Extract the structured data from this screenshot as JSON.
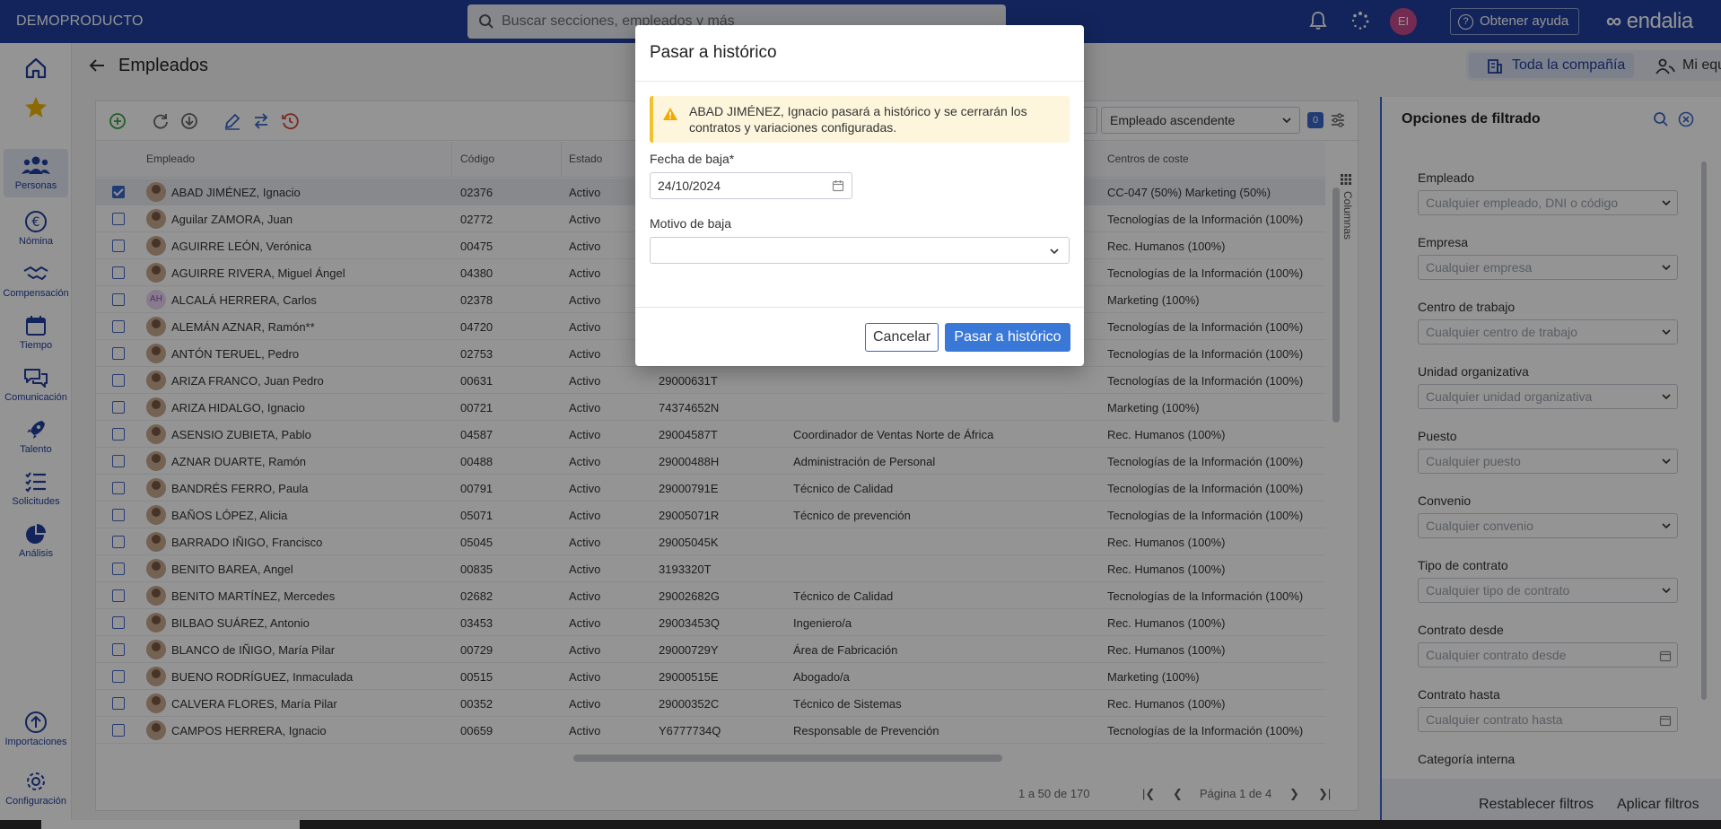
{
  "topbar": {
    "brand": "DEMOPRODUCTO",
    "search_placeholder": "Buscar secciones, empleados y más",
    "avatar_initials": "EI",
    "help_label": "Obtener ayuda",
    "logo_text": "endalia"
  },
  "leftnav": {
    "items": [
      {
        "label": "",
        "icon": "home-icon"
      },
      {
        "label": "",
        "icon": "star-icon"
      },
      {
        "label": "Personas",
        "icon": "people-icon"
      },
      {
        "label": "Nómina",
        "icon": "euro-icon"
      },
      {
        "label": "Compensación",
        "icon": "handshake-icon"
      },
      {
        "label": "Tiempo",
        "icon": "calendar-icon"
      },
      {
        "label": "Comunicación",
        "icon": "chat-icon"
      },
      {
        "label": "Talento",
        "icon": "rocket-icon"
      },
      {
        "label": "Solicitudes",
        "icon": "checklist-icon"
      },
      {
        "label": "Análisis",
        "icon": "pie-icon"
      },
      {
        "label": "Importaciones",
        "icon": "upload-icon"
      },
      {
        "label": "Configuración",
        "icon": "gear-icon"
      }
    ]
  },
  "page": {
    "title": "Empleados",
    "scope_tabs": [
      "Toda la compañía",
      "Mi equipo"
    ]
  },
  "grid": {
    "sort_value": "Empleado ascendente",
    "filter_count": "0",
    "columns_label": "Columnas",
    "headers": {
      "employee": "Empleado",
      "code": "Código",
      "state": "Estado",
      "cost_centers": "Centros de coste"
    },
    "rows": [
      {
        "name": "ABAD JIMÉNEZ, Ignacio",
        "code": "02376",
        "state": "Activo",
        "dni": "",
        "position": "",
        "cc": "CC-047 (50%) Marketing (50%)",
        "selected": true
      },
      {
        "name": "Aguilar ZAMORA, Juan",
        "code": "02772",
        "state": "Activo",
        "dni": "",
        "position": "",
        "cc": "Tecnologías de la Información (100%)"
      },
      {
        "name": "AGUIRRE LEÓN, Verónica",
        "code": "00475",
        "state": "Activo",
        "dni": "",
        "position": "",
        "cc": "Rec. Humanos (100%)"
      },
      {
        "name": "AGUIRRE RIVERA, Miguel Ángel",
        "code": "04380",
        "state": "Activo",
        "dni": "",
        "position": "",
        "cc": "Tecnologías de la Información (100%)"
      },
      {
        "name": "ALCALÁ HERRERA, Carlos",
        "code": "02378",
        "state": "Activo",
        "dni": "",
        "position": "",
        "cc": "Marketing (100%)",
        "initials": "AH"
      },
      {
        "name": "ALEMÁN AZNAR, Ramón**",
        "code": "04720",
        "state": "Activo",
        "dni": "",
        "position": "",
        "cc": "Tecnologías de la Información (100%)"
      },
      {
        "name": "ANTÓN TERUEL, Pedro",
        "code": "02753",
        "state": "Activo",
        "dni": "",
        "position": "",
        "cc": "Tecnologías de la Información (100%)"
      },
      {
        "name": "ARIZA FRANCO, Juan Pedro",
        "code": "00631",
        "state": "Activo",
        "dni": "29000631T",
        "position": "",
        "cc": "Tecnologías de la Información (100%)"
      },
      {
        "name": "ARIZA HIDALGO, Ignacio",
        "code": "00721",
        "state": "Activo",
        "dni": "74374652N",
        "position": "",
        "cc": "Marketing (100%)"
      },
      {
        "name": "ASENSIO ZUBIETA, Pablo",
        "code": "04587",
        "state": "Activo",
        "dni": "29004587T",
        "position": "Coordinador de Ventas Norte de África",
        "cc": "Rec. Humanos (100%)"
      },
      {
        "name": "AZNAR DUARTE, Ramón",
        "code": "00488",
        "state": "Activo",
        "dni": "29000488H",
        "position": "Administración de Personal",
        "cc": "Tecnologías de la Información (100%)"
      },
      {
        "name": "BANDRÉS FERRO, Paula",
        "code": "00791",
        "state": "Activo",
        "dni": "29000791E",
        "position": "Técnico de Calidad",
        "cc": "Tecnologías de la Información (100%)"
      },
      {
        "name": "BAÑOS LÓPEZ, Alicia",
        "code": "05071",
        "state": "Activo",
        "dni": "29005071R",
        "position": "Técnico de prevención",
        "cc": "Tecnologías de la Información (100%)"
      },
      {
        "name": "BARRADO IÑIGO, Francisco",
        "code": "05045",
        "state": "Activo",
        "dni": "29005045K",
        "position": "",
        "cc": "Rec. Humanos (100%)"
      },
      {
        "name": "BENITO BAREA, Angel",
        "code": "00835",
        "state": "Activo",
        "dni": "3193320T",
        "position": "",
        "cc": "Rec. Humanos (100%)"
      },
      {
        "name": "BENITO MARTÍNEZ, Mercedes",
        "code": "02682",
        "state": "Activo",
        "dni": "29002682G",
        "position": "Técnico de Calidad",
        "cc": "Tecnologías de la Información (100%)"
      },
      {
        "name": "BILBAO SUÁREZ, Antonio",
        "code": "03453",
        "state": "Activo",
        "dni": "29003453Q",
        "position": "Ingeniero/a",
        "cc": "Rec. Humanos (100%)"
      },
      {
        "name": "BLANCO de IÑIGO, María Pilar",
        "code": "00729",
        "state": "Activo",
        "dni": "29000729Y",
        "position": "Área de Fabricación",
        "cc": "Rec. Humanos (100%)"
      },
      {
        "name": "BUENO RODRÍGUEZ, Inmaculada",
        "code": "00515",
        "state": "Activo",
        "dni": "29000515E",
        "position": "Abogado/a",
        "cc": "Marketing (100%)"
      },
      {
        "name": "CALVERA FLORES, María Pilar",
        "code": "00352",
        "state": "Activo",
        "dni": "29000352C",
        "position": "Técnico de Sistemas",
        "cc": "Rec. Humanos (100%)"
      },
      {
        "name": "CAMPOS HERRERA, Ignacio",
        "code": "00659",
        "state": "Activo",
        "dni": "Y6777734Q",
        "position": "Responsable de Prevención",
        "cc": "Tecnologías de la Información (100%)"
      }
    ],
    "pager": {
      "range": "1 a 50 de 170",
      "page": "Página 1 de 4"
    }
  },
  "filters": {
    "title": "Opciones de filtrado",
    "fields": [
      {
        "label": "Empleado",
        "placeholder": "Cualquier empleado, DNI o código",
        "kind": "select"
      },
      {
        "label": "Empresa",
        "placeholder": "Cualquier empresa",
        "kind": "select"
      },
      {
        "label": "Centro de trabajo",
        "placeholder": "Cualquier centro de trabajo",
        "kind": "select"
      },
      {
        "label": "Unidad organizativa",
        "placeholder": "Cualquier unidad organizativa",
        "kind": "select"
      },
      {
        "label": "Puesto",
        "placeholder": "Cualquier puesto",
        "kind": "select"
      },
      {
        "label": "Convenio",
        "placeholder": "Cualquier convenio",
        "kind": "select"
      },
      {
        "label": "Tipo de contrato",
        "placeholder": "Cualquier tipo de contrato",
        "kind": "select"
      },
      {
        "label": "Contrato desde",
        "placeholder": "Cualquier contrato desde",
        "kind": "date"
      },
      {
        "label": "Contrato hasta",
        "placeholder": "Cualquier contrato hasta",
        "kind": "date"
      }
    ],
    "next_label": "Categoría interna",
    "reset_label": "Restablecer filtros",
    "apply_label": "Aplicar filtros"
  },
  "modal": {
    "title": "Pasar a histórico",
    "warning": "ABAD JIMÉNEZ, Ignacio pasará a histórico y se cerrarán los contratos y variaciones configuradas.",
    "date_label": "Fecha de baja*",
    "date_value": "24/10/2024",
    "reason_label": "Motivo de baja",
    "reason_value": "",
    "cancel_label": "Cancelar",
    "confirm_label": "Pasar a histórico"
  },
  "colors": {
    "brand_blue": "#1f3f9e",
    "accent_blue": "#3a78d8",
    "warning_yellow": "#f2c12e"
  }
}
